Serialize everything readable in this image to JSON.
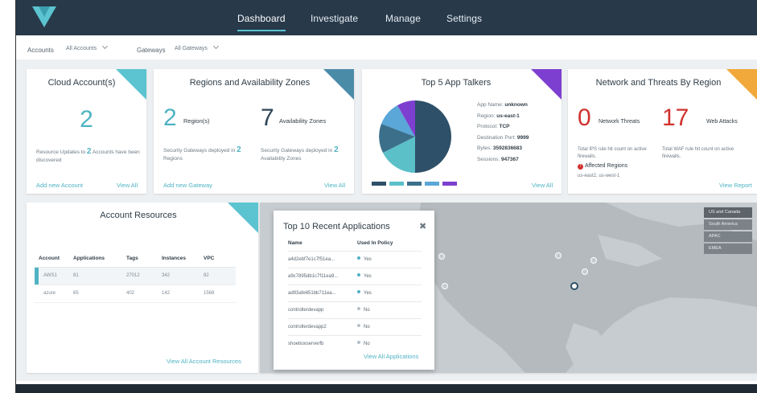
{
  "nav": {
    "tabs": [
      {
        "label": "Dashboard",
        "active": true
      },
      {
        "label": "Investigate"
      },
      {
        "label": "Manage"
      },
      {
        "label": "Settings"
      }
    ]
  },
  "filters": {
    "accounts_label": "Accounts",
    "accounts_value": "All Accounts",
    "gateways_label": "Gateways",
    "gateways_value": "All Gateways"
  },
  "cloud_accounts": {
    "title": "Cloud Account(s)",
    "count": "2",
    "update_pre": "Resource Updates to",
    "update_num": "2",
    "update_post": "Accounts have been discovered",
    "add_link": "Add new Account",
    "view_link": "View All"
  },
  "regions": {
    "title": "Regions and Availability Zones",
    "regions_count": "2",
    "regions_label": "Region(s)",
    "zones_count": "7",
    "zones_label": "Availability Zones",
    "regions_note_pre": "Security Gateways deployed in",
    "regions_note_num": "2",
    "regions_note_post": "Regions",
    "zones_note_pre": "Security Gateways deployed in",
    "zones_note_num": "2",
    "zones_note_post": "Availability Zones",
    "add_link": "Add new Gateway",
    "view_link": "View All"
  },
  "talkers": {
    "title": "Top 5 App Talkers",
    "details": [
      {
        "label": "App Name:",
        "value": "unknown"
      },
      {
        "label": "Region:",
        "value": "us-east-1"
      },
      {
        "label": "Protocol:",
        "value": "TCP"
      },
      {
        "label": "Destination Port:",
        "value": "9999"
      },
      {
        "label": "Bytes:",
        "value": "3592836683"
      },
      {
        "label": "Sessions:",
        "value": "947367"
      }
    ],
    "view_link": "View All",
    "colors": [
      "#2e5068",
      "#5bc0c8",
      "#3b6f8a",
      "#5aa7d8",
      "#7d3fcf"
    ]
  },
  "threats": {
    "title": "Network and Threats By Region",
    "network_count": "0",
    "network_label": "Network Threats",
    "web_count": "17",
    "web_label": "Web Attacks",
    "network_note": "Total IPS rule hit count on active firewalls.",
    "web_note": "Total WAF rule hit count on active firewalls.",
    "affected_label": "Affected Regions",
    "affected_value": "us-east2, us-west-1",
    "view_link": "View Report"
  },
  "account_resources": {
    "title": "Account Resources",
    "columns": [
      "Account",
      "Applications",
      "Tags",
      "Instances",
      "VPC"
    ],
    "rows": [
      [
        "AWS1",
        "81",
        "27012",
        "342",
        "82"
      ],
      [
        "azure",
        "65",
        "402",
        "142",
        "1568"
      ]
    ],
    "view_link": "View All Account Resources"
  },
  "recent_apps": {
    "title": "Top 10 Recent Applications",
    "columns": [
      "Name",
      "Used In Policy"
    ],
    "rows": [
      {
        "name": "a4d2ebf7e1c7f51ea...",
        "used": "Yes"
      },
      {
        "name": "a9c7895db1c7f11ea9...",
        "used": "Yes"
      },
      {
        "name": "ad93afe651bb711ea...",
        "used": "Yes"
      },
      {
        "name": "controllerdevapp",
        "used": "No"
      },
      {
        "name": "controllerdevapp2",
        "used": "No"
      },
      {
        "name": "shoeboxserverfb",
        "used": "No"
      }
    ],
    "view_link": "View All Applications"
  },
  "map": {
    "regions": [
      {
        "label": "US and Canada",
        "active": true
      },
      {
        "label": "South America"
      },
      {
        "label": "APAC"
      },
      {
        "label": "EMEA"
      }
    ]
  }
}
